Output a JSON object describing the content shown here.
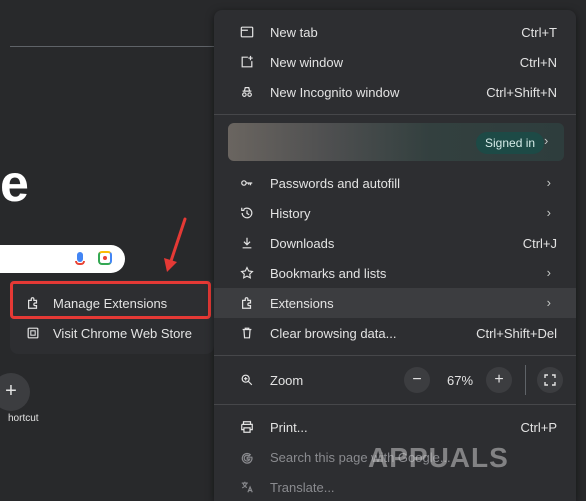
{
  "background": {
    "big_letter": "e",
    "shortcut_plus": "+",
    "shortcut_label": "hortcut"
  },
  "submenu": {
    "manage_extensions": "Manage Extensions",
    "visit_store": "Visit Chrome Web Store"
  },
  "menu": {
    "new_tab": {
      "label": "New tab",
      "shortcut": "Ctrl+T"
    },
    "new_window": {
      "label": "New window",
      "shortcut": "Ctrl+N"
    },
    "new_incognito": {
      "label": "New Incognito window",
      "shortcut": "Ctrl+Shift+N"
    },
    "profile": {
      "status": "Signed in"
    },
    "passwords": {
      "label": "Passwords and autofill"
    },
    "history": {
      "label": "History"
    },
    "downloads": {
      "label": "Downloads",
      "shortcut": "Ctrl+J"
    },
    "bookmarks": {
      "label": "Bookmarks and lists"
    },
    "extensions": {
      "label": "Extensions"
    },
    "clear_data": {
      "label": "Clear browsing data...",
      "shortcut": "Ctrl+Shift+Del"
    },
    "zoom": {
      "label": "Zoom",
      "value": "67%",
      "minus": "−",
      "plus": "+"
    },
    "print": {
      "label": "Print...",
      "shortcut": "Ctrl+P"
    },
    "search_page": {
      "label": "Search this page with Google..."
    },
    "translate": {
      "label": "Translate..."
    }
  },
  "watermark": "APPUALS",
  "colors": {
    "menu_bg": "#2d2e31",
    "highlight": "#3c3d40",
    "annotation_red": "#e53935",
    "signed_in_pill": "#1d4a46"
  },
  "icons": [
    "new-tab-icon",
    "new-window-icon",
    "incognito-icon",
    "key-icon",
    "history-icon",
    "download-icon",
    "star-icon",
    "puzzle-icon",
    "trash-icon",
    "zoom-icon",
    "fullscreen-icon",
    "print-icon",
    "google-g-icon",
    "translate-icon",
    "chevron-right-icon",
    "mic-icon",
    "lens-icon",
    "store-icon",
    "red-arrow-icon"
  ]
}
